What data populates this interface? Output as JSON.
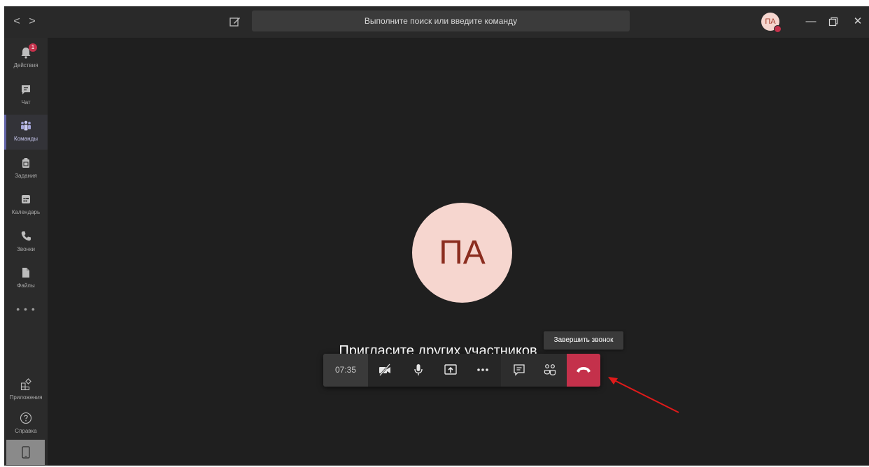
{
  "titlebar": {
    "back_glyph": "<",
    "forward_glyph": ">",
    "search_placeholder": "Выполните поиск или введите команду",
    "user_initials": "ПА",
    "minimize_glyph": "—",
    "close_glyph": "✕"
  },
  "rail": {
    "items": [
      {
        "label": "Действия",
        "icon": "bell-icon",
        "badge": "1"
      },
      {
        "label": "Чат",
        "icon": "chat-icon"
      },
      {
        "label": "Команды",
        "icon": "teams-icon",
        "active": true
      },
      {
        "label": "Задания",
        "icon": "assignments-icon"
      },
      {
        "label": "Календарь",
        "icon": "calendar-icon"
      },
      {
        "label": "Звонки",
        "icon": "phone-icon"
      },
      {
        "label": "Файлы",
        "icon": "file-icon"
      }
    ],
    "more": "• • •",
    "apps_label": "Приложения",
    "help_label": "Справка"
  },
  "stage": {
    "avatar_initials": "ПА",
    "invite_text": "Пригласите других участников"
  },
  "callbar": {
    "timer": "07:35",
    "tooltip": "Завершить звонок",
    "hangup_color": "#c4314b"
  },
  "colors": {
    "accent": "#6264a7",
    "avatar_bg": "#f6d6cf",
    "annotation_arrow": "#e01a1a"
  }
}
